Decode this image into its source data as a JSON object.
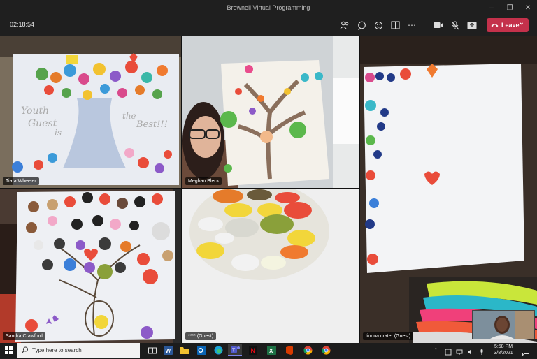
{
  "window": {
    "title": "Brownell Virtual Programming"
  },
  "meeting": {
    "timer": "02:18:54",
    "leave_label": "Leave"
  },
  "participants": [
    {
      "name": "Tiara Wheeler"
    },
    {
      "name": "Meghan Bleck"
    },
    {
      "name": "tionna crater (Guest)"
    },
    {
      "name": "Sandra Crawford"
    },
    {
      "name": "**** (Guest)"
    }
  ],
  "artwork": {
    "poster_text_1": "Youth",
    "poster_text_2": "Guest",
    "poster_text_3": "is",
    "poster_text_4": "the",
    "poster_text_5": "Best!!!"
  },
  "taskbar": {
    "search_placeholder": "Type here to search",
    "time": "5:58 PM",
    "date": "3/8/2021"
  },
  "colors": {
    "leave": "#c4314b",
    "background": "#1f1f1f"
  }
}
